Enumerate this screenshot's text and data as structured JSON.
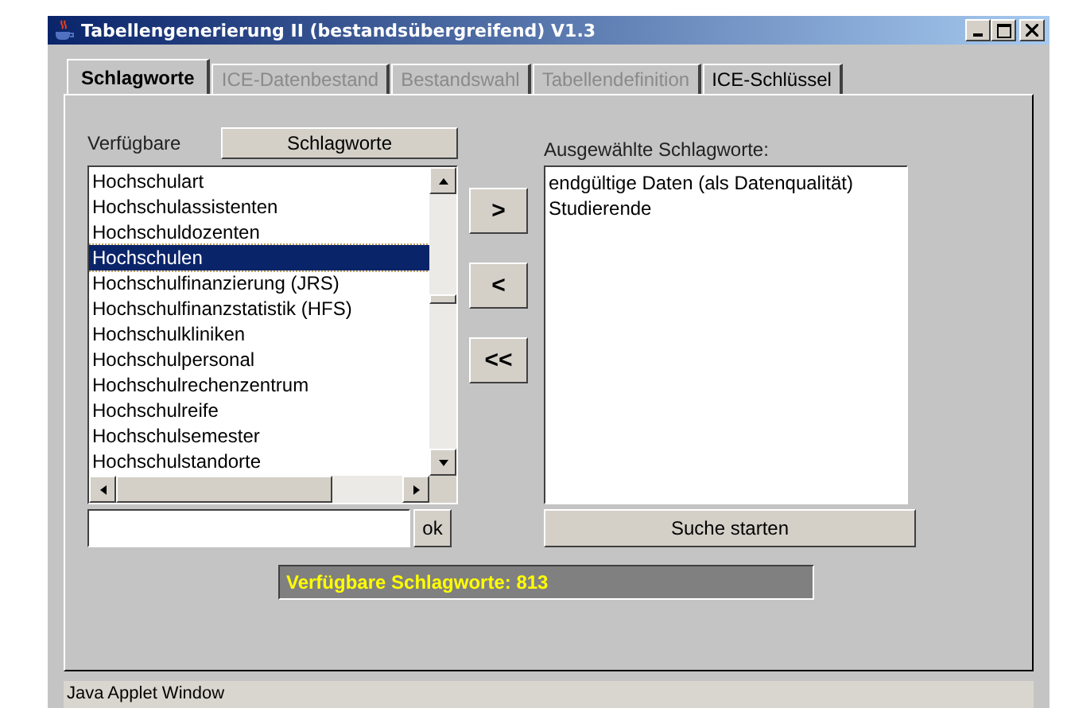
{
  "window": {
    "title": "Tabellengenerierung II (bestandsübergreifend) V1.3"
  },
  "tabs": [
    {
      "label": "Schlagworte",
      "selected": true,
      "disabled": false
    },
    {
      "label": "ICE-Datenbestand",
      "selected": false,
      "disabled": true
    },
    {
      "label": "Bestandswahl",
      "selected": false,
      "disabled": true
    },
    {
      "label": "Tabellendefinition",
      "selected": false,
      "disabled": true
    },
    {
      "label": "ICE-Schlüssel",
      "selected": false,
      "disabled": false
    }
  ],
  "available": {
    "label": "Verfügbare",
    "button": "Schlagworte",
    "items": [
      {
        "label": "Hochschulart",
        "selected": false
      },
      {
        "label": "Hochschulassistenten",
        "selected": false
      },
      {
        "label": "Hochschuldozenten",
        "selected": false
      },
      {
        "label": "Hochschulen",
        "selected": true
      },
      {
        "label": "Hochschulfinanzierung (JRS)",
        "selected": false
      },
      {
        "label": "Hochschulfinanzstatistik (HFS)",
        "selected": false
      },
      {
        "label": "Hochschulkliniken",
        "selected": false
      },
      {
        "label": "Hochschulpersonal",
        "selected": false
      },
      {
        "label": "Hochschulrechenzentrum",
        "selected": false
      },
      {
        "label": "Hochschulreife",
        "selected": false
      },
      {
        "label": "Hochschulsemester",
        "selected": false
      },
      {
        "label": "Hochschulstandorte",
        "selected": false
      }
    ],
    "ok_button": "ok"
  },
  "move_buttons": [
    ">",
    "<",
    "<<"
  ],
  "selected_keywords": {
    "label": "Ausgewählte Schlagworte:",
    "items": [
      "endgültige Daten (als Datenqualität)",
      "Studierende"
    ],
    "button": "Suche starten"
  },
  "count_bar": "Verfügbare Schlagworte: 813",
  "status_bar": "Java Applet Window"
}
